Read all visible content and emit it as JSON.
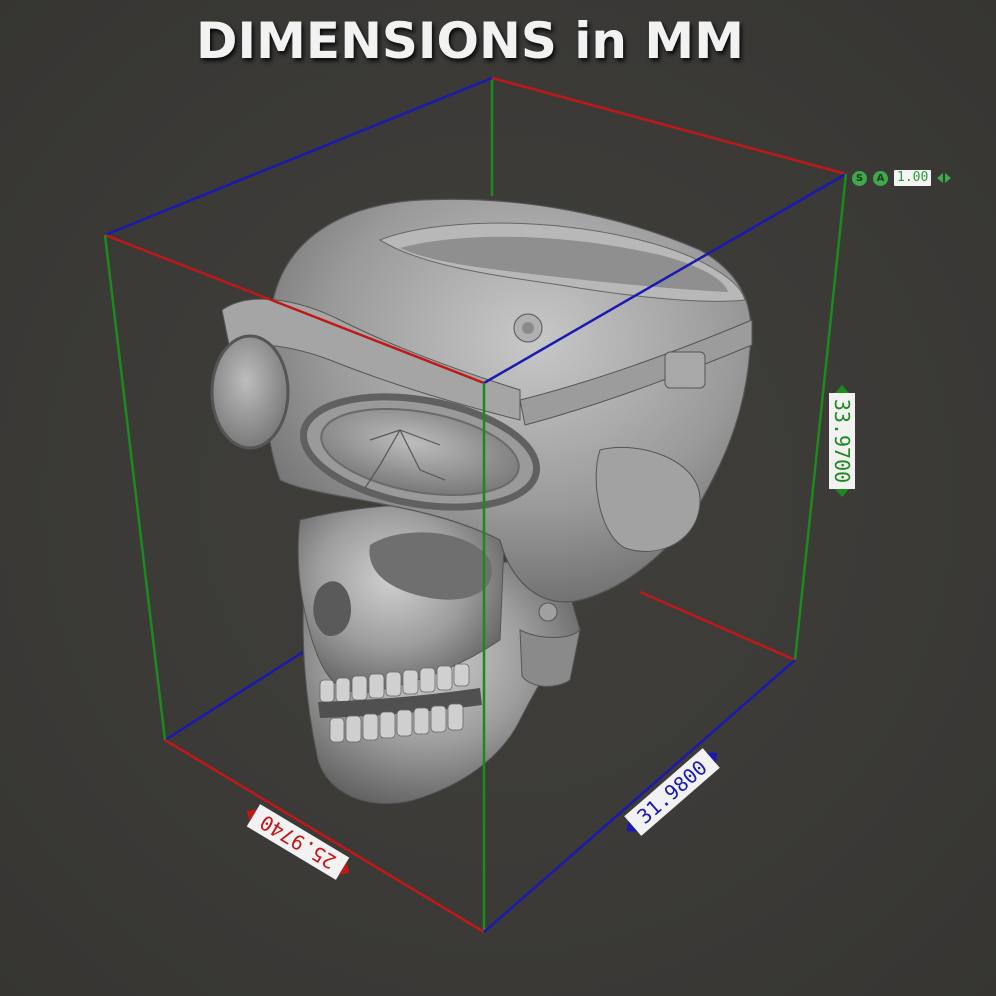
{
  "title": "DIMENSIONS in MM",
  "dimensions": {
    "width_x": "25.9740",
    "depth_y": "31.9800",
    "height_z": "33.9700"
  },
  "scale_widget": {
    "s_label": "S",
    "a_label": "A",
    "value": "1.00"
  },
  "colors": {
    "x_axis": "#c01818",
    "y_axis": "#1a1ab0",
    "z_axis": "#1d8a1d",
    "background": "#3b3a37",
    "model": "#a9a9a9"
  },
  "icons": [
    "circle-s-icon",
    "circle-a-icon",
    "arrow-left-icon",
    "arrow-right-icon",
    "double-arrow-icon"
  ]
}
